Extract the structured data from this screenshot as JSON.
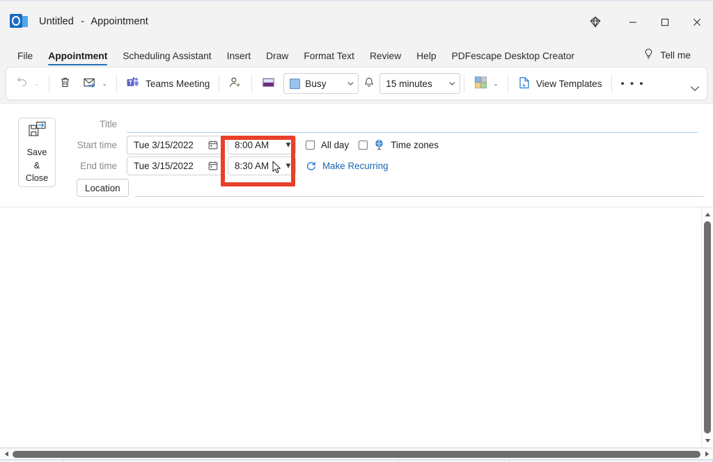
{
  "window": {
    "title_name": "Untitled",
    "title_sep": "-",
    "title_type": "Appointment",
    "app_icon": "outlook-icon",
    "controls": {
      "diamond": "diamond-icon",
      "minimize": "minimize-icon",
      "maximize": "maximize-icon",
      "close": "close-icon"
    }
  },
  "tabs": [
    {
      "label": "File",
      "active": false
    },
    {
      "label": "Appointment",
      "active": true
    },
    {
      "label": "Scheduling Assistant",
      "active": false
    },
    {
      "label": "Insert",
      "active": false
    },
    {
      "label": "Draw",
      "active": false
    },
    {
      "label": "Format Text",
      "active": false
    },
    {
      "label": "Review",
      "active": false
    },
    {
      "label": "Help",
      "active": false
    },
    {
      "label": "PDFescape Desktop Creator",
      "active": false
    }
  ],
  "tellme": {
    "label": "Tell me",
    "icon": "lightbulb-icon"
  },
  "ribbon": {
    "undo": {
      "icon": "undo-icon",
      "caret": "⌄"
    },
    "delete": {
      "icon": "trash-icon"
    },
    "forward": {
      "icon": "forward-mail-icon",
      "caret": "⌄"
    },
    "teams_meeting": {
      "label": "Teams Meeting",
      "icon": "teams-icon"
    },
    "invite_attendees": {
      "icon": "invite-attendees-icon"
    },
    "show_as_icon": "show-as-icon",
    "show_as": {
      "value": "Busy",
      "caret": "⌄",
      "swatch": "#9ac2ea"
    },
    "reminder_icon": "bell-icon",
    "reminder": {
      "value": "15 minutes",
      "caret": "⌄"
    },
    "categorize": {
      "icon": "categorize-icon",
      "caret": "⌄"
    },
    "view_templates": {
      "label": "View Templates",
      "icon": "view-templates-icon"
    },
    "overflow": {
      "label": "• • •"
    },
    "collapse": {
      "icon": "chevron-down-icon"
    }
  },
  "form": {
    "save_close": {
      "line1": "Save",
      "line2": "&",
      "line3": "Close",
      "icon": "save-close-icon"
    },
    "title": {
      "label": "Title",
      "value": "",
      "placeholder": ""
    },
    "start": {
      "label": "Start time",
      "date": "Tue 3/15/2022",
      "time": "8:00 AM",
      "date_icon": "calendar-icon",
      "caret": "▾"
    },
    "end": {
      "label": "End time",
      "date": "Tue 3/15/2022",
      "time": "8:30 AM",
      "date_icon": "calendar-icon",
      "caret": "▾"
    },
    "all_day": {
      "label": "All day",
      "checked": false
    },
    "time_zones": {
      "label": "Time zones",
      "checked": false,
      "icon": "globe-icon"
    },
    "make_recurring": {
      "label": "Make Recurring",
      "icon": "recurring-icon"
    },
    "location": {
      "label": "Location",
      "value": "",
      "placeholder": ""
    },
    "highlight_color": "#e8402a"
  },
  "body": {
    "text": ""
  },
  "scrollbars": {
    "vertical": {
      "up": "scroll-up-arrow",
      "down": "scroll-down-arrow"
    },
    "horizontal": {
      "left": "scroll-left-arrow",
      "right": "scroll-right-arrow"
    }
  }
}
